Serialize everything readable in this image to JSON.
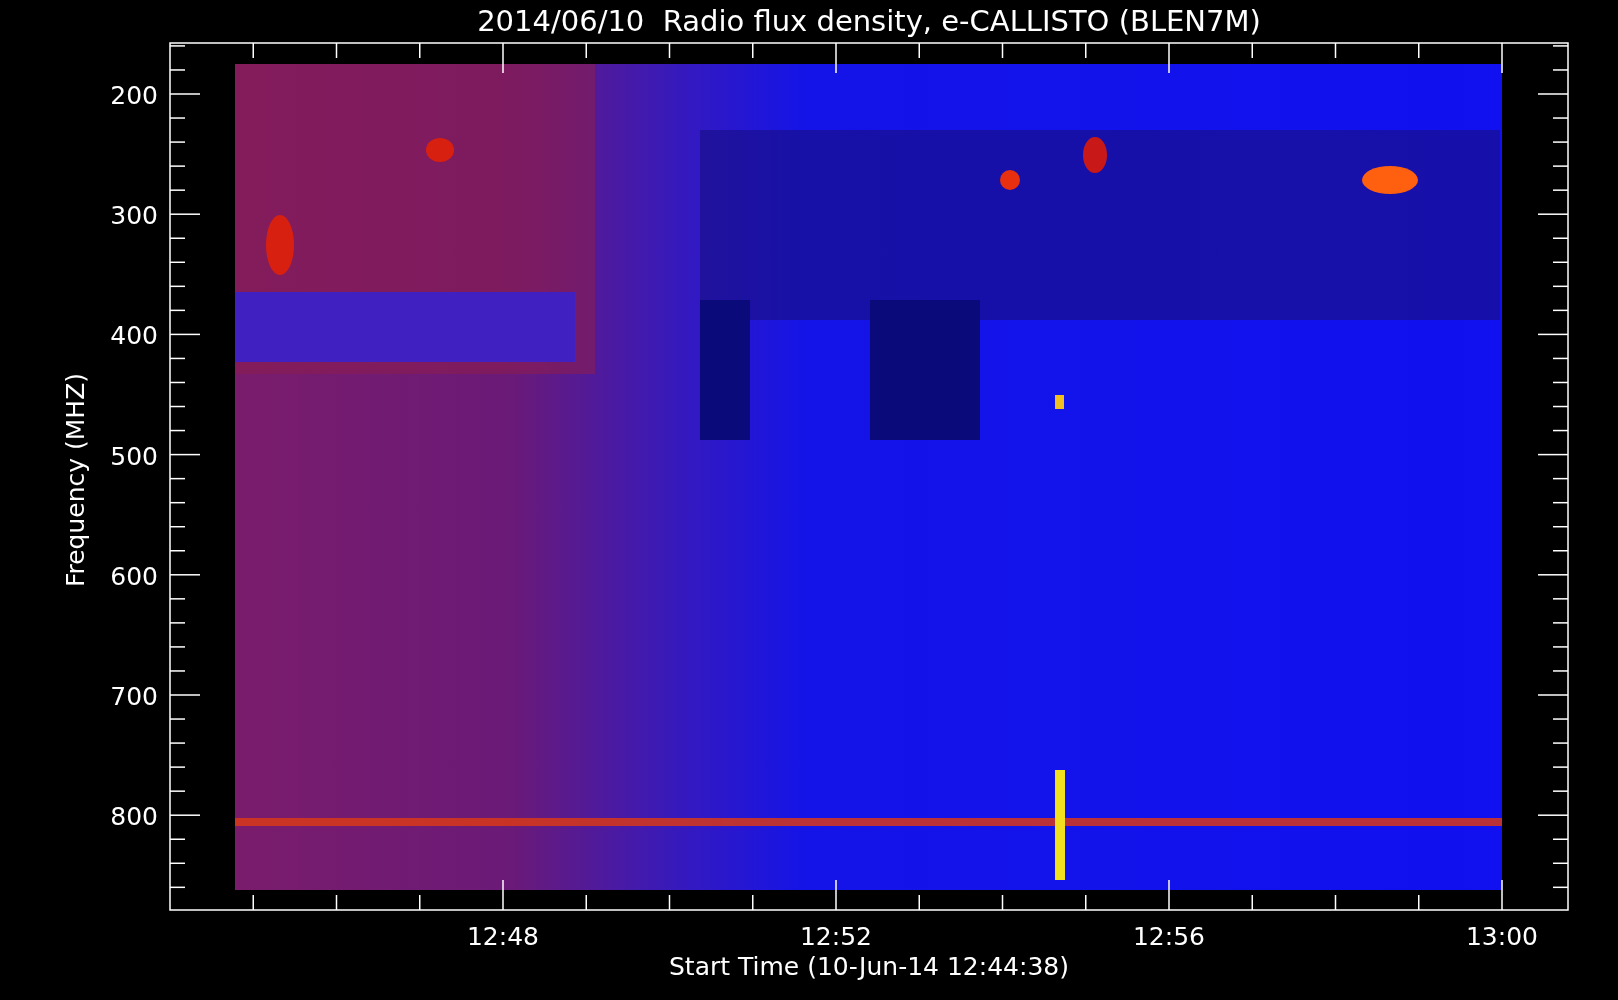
{
  "title": "2014/06/10  Radio flux density, e-CALLISTO (BLEN7M)",
  "plot": {
    "ylabel": "Frequency (MHZ)",
    "xlabel": "Start Time (10-Jun-14 12:44:38)",
    "yticks": [
      "200",
      "300",
      "400",
      "500",
      "600",
      "700",
      "800"
    ],
    "xticks": [
      "12:48",
      "12:52",
      "12:56",
      "13:00"
    ]
  }
}
